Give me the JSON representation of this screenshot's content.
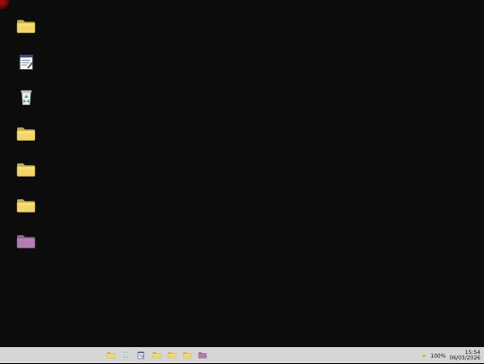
{
  "desktop": {
    "icons": [
      {
        "name": "folder-icon",
        "kind": "folder",
        "color": "#f3d66b"
      },
      {
        "name": "notepad-icon",
        "kind": "notepad"
      },
      {
        "name": "recycle-bin-icon",
        "kind": "recycle"
      },
      {
        "name": "folder-icon",
        "kind": "folder",
        "color": "#f3d66b"
      },
      {
        "name": "folder-icon",
        "kind": "folder",
        "color": "#f3d66b"
      },
      {
        "name": "folder-icon",
        "kind": "folder",
        "color": "#f3d66b"
      },
      {
        "name": "folder-icon",
        "kind": "folder",
        "color": "#b37bb2"
      }
    ]
  },
  "taskbar": {
    "apps": [
      {
        "name": "folder-icon",
        "kind": "folder",
        "color": "#f3d66b"
      },
      {
        "name": "recycle-bin-icon",
        "kind": "recycle"
      },
      {
        "name": "notepad-icon",
        "kind": "notepad"
      },
      {
        "name": "folder-icon",
        "kind": "folder",
        "color": "#f3d66b"
      },
      {
        "name": "folder-icon",
        "kind": "folder",
        "color": "#f3d66b"
      },
      {
        "name": "folder-icon",
        "kind": "folder",
        "color": "#f3d66b"
      },
      {
        "name": "folder-icon",
        "kind": "folder",
        "color": "#b37bb2"
      }
    ],
    "tray": {
      "battery_icon": "battery-icon",
      "battery_percent": "100%",
      "time": "15:54",
      "date": "06/03/2026"
    }
  }
}
